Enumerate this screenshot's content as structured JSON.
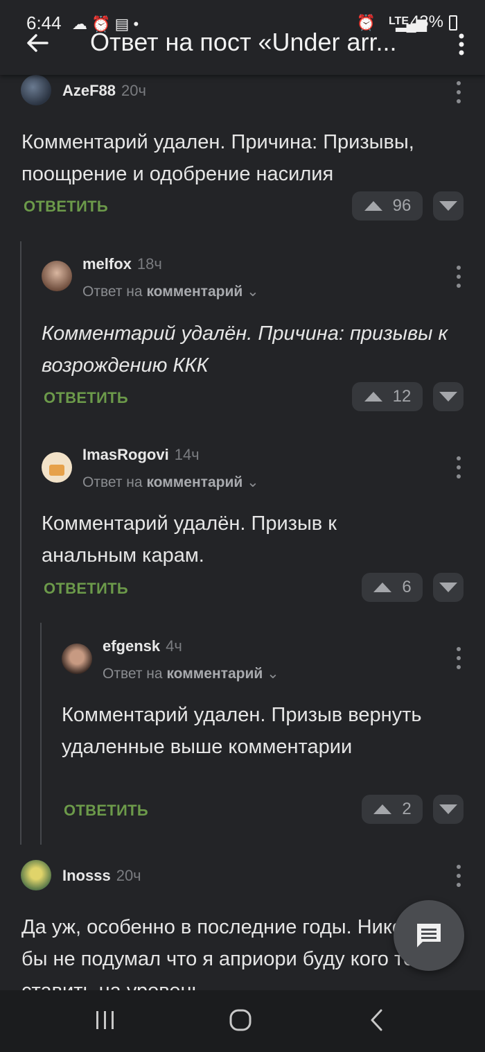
{
  "status": {
    "time": "6:44",
    "network": "LTE",
    "battery": "43%"
  },
  "header": {
    "title": "Ответ на пост «Under arr..."
  },
  "comments": [
    {
      "username": "AzeF88",
      "time": "20ч",
      "text": "Комментарий удален. Причина: Призывы, поощрение и одобрение насилия",
      "reply_label": "ОТВЕТИТЬ",
      "votes": "96"
    },
    {
      "username": "melfox",
      "time": "18ч",
      "reply_to_prefix": "Ответ на",
      "reply_to_link": "комментарий",
      "text": "Комментарий удалён. Причина: призывы к возрождению ККК",
      "reply_label": "ОТВЕТИТЬ",
      "votes": "12"
    },
    {
      "username": "ImasRogovi",
      "time": "14ч",
      "reply_to_prefix": "Ответ на",
      "reply_to_link": "комментарий",
      "text": "Комментарий удалён. Призыв к анальным карам.",
      "reply_label": "ОТВЕТИТЬ",
      "votes": "6"
    },
    {
      "username": "efgensk",
      "time": "4ч",
      "reply_to_prefix": "Ответ на",
      "reply_to_link": "комментарий",
      "text": "Комментарий удален. Призыв вернуть удаленные выше комментарии",
      "reply_label": "ОТВЕТИТЬ",
      "votes": "2"
    },
    {
      "username": "Inosss",
      "time": "20ч",
      "text": "Да уж, особенно в последние годы. Никогда бы не подумал что я априори буду кого то ставить на уровень"
    }
  ],
  "icons": {
    "back": "arrow-left-icon",
    "menu": "more-vertical-icon",
    "upvote": "triangle-up-icon",
    "downvote": "triangle-down-icon",
    "fab": "comment-icon",
    "nav_recent": "recent-apps-icon",
    "nav_home": "home-icon",
    "nav_back": "back-icon"
  },
  "colors": {
    "background": "#232427",
    "reply_green": "#6c9a4a",
    "vote_bg": "#36383c"
  }
}
